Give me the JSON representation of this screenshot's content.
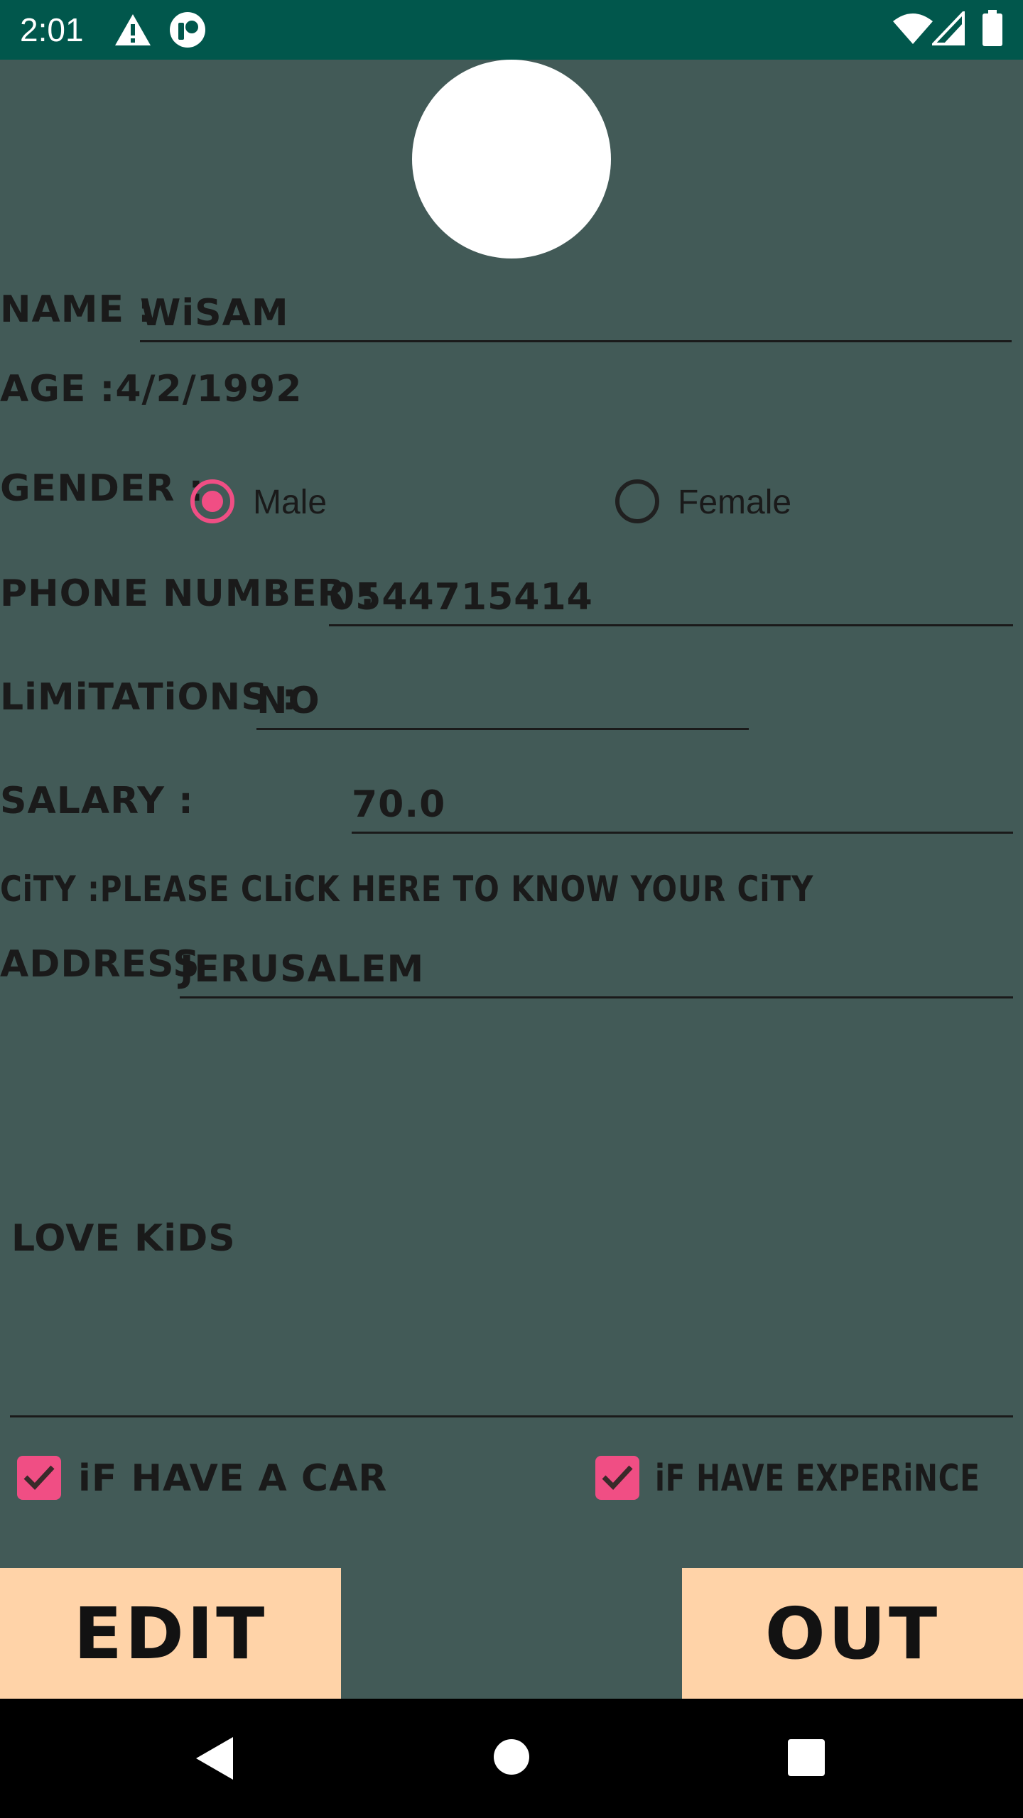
{
  "status_bar": {
    "time": "2:01",
    "icons": [
      "alert-icon",
      "app-notification-icon",
      "wifi-icon",
      "signal-icon",
      "battery-icon"
    ]
  },
  "profile": {
    "avatar": "avatar",
    "name_label": "NAME :",
    "name_value": "WiSAM",
    "age_text": "AGE :4/2/1992",
    "gender_label": "GENDER :",
    "gender_options": [
      "Male",
      "Female"
    ],
    "gender_selected": "Male",
    "phone_label": "PHONE NUMBER :",
    "phone_value": "0544715414",
    "limitations_label": "LiMiTATiONS :",
    "limitations_value": "NO",
    "salary_label": "SALARY :",
    "salary_value": "70.0",
    "city_text": "CiTY :PLEASE CLiCK HERE TO KNOW YOUR CiTY",
    "address_label": "ADDRESS",
    "address_value": "JERUSALEM",
    "notes_value": "LOVE KiDS",
    "checkbox_car": "iF HAVE A CAR",
    "checkbox_experience": "iF HAVE EXPERiNCE",
    "checkbox_car_checked": true,
    "checkbox_experience_checked": true
  },
  "buttons": {
    "edit": "EDIT",
    "out": "OUT"
  },
  "colors": {
    "background": "#425a57",
    "status_bar": "#01574c",
    "accent": "#f04e84",
    "button": "#ffd3a8",
    "text": "#1a1a1a"
  }
}
